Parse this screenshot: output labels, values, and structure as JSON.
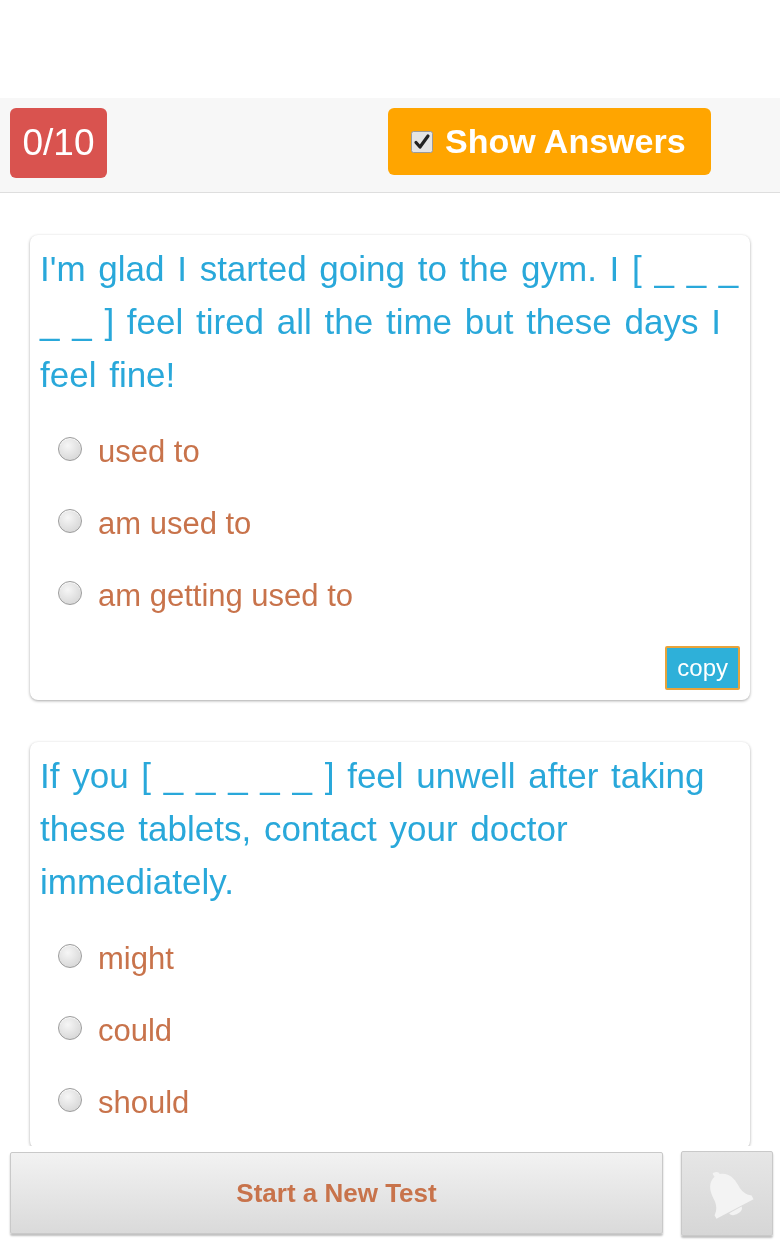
{
  "toolbar": {
    "score": "0/10",
    "show_answers": {
      "label": "Show Answers",
      "checked": true
    }
  },
  "questions": [
    {
      "text": "I'm glad I started going to the gym. I [ _ _ _ _ _ ] feel tired all the time but these days I feel fine!",
      "options": [
        {
          "label": "used to",
          "selected": false
        },
        {
          "label": "am used to",
          "selected": false
        },
        {
          "label": "am getting used to",
          "selected": false
        }
      ],
      "copy_button": "copy"
    },
    {
      "text": "If you [ _ _ _ _ _ ] feel unwell after taking these tablets, contact your doctor immediately.",
      "options": [
        {
          "label": "might",
          "selected": false
        },
        {
          "label": "could",
          "selected": false
        },
        {
          "label": "should",
          "selected": false
        }
      ]
    }
  ],
  "footer": {
    "new_test_button": "Start a New Test"
  }
}
